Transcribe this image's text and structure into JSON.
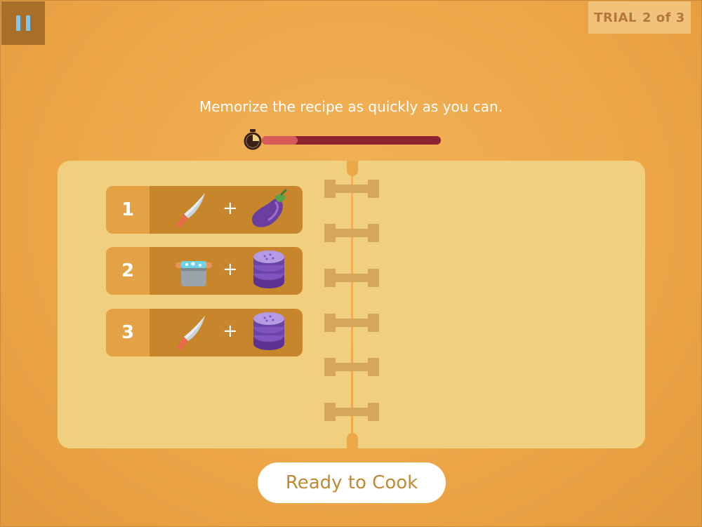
{
  "header": {
    "trial_label": "TRIAL",
    "trial_value": "2 of 3"
  },
  "instruction": "Memorize the recipe as quickly as you can.",
  "timer": {
    "progress_fraction": 0.2,
    "colors": {
      "fill": "#d65a5a",
      "track": "#8e2330"
    }
  },
  "recipe": {
    "steps": [
      {
        "number": "1",
        "tool_icon": "knife-icon",
        "operator": "+",
        "ingredient_icon": "eggplant-icon"
      },
      {
        "number": "2",
        "tool_icon": "pot-icon",
        "operator": "+",
        "ingredient_icon": "eggplant-slices-icon"
      },
      {
        "number": "3",
        "tool_icon": "knife-icon",
        "operator": "+",
        "ingredient_icon": "eggplant-slices-icon"
      }
    ]
  },
  "ready_button": {
    "label": "Ready to Cook"
  },
  "colors": {
    "background": "#eda648",
    "page": "#f0cf7f",
    "step_number_bg": "#e5a244",
    "step_bg": "#c7862b",
    "pause_icon": "#7ec7ee",
    "button_text": "#bf8936"
  }
}
